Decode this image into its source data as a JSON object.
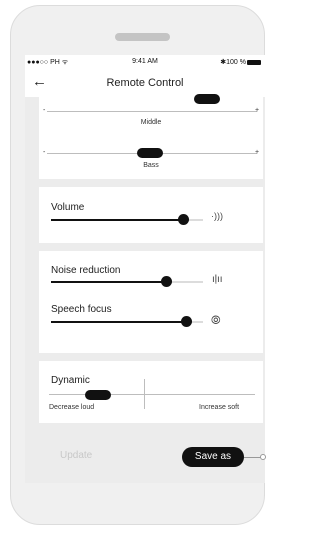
{
  "status_bar": {
    "carrier": "●●●○○ PH ᯤ",
    "time": "9:41 AM",
    "battery": "✱100 %"
  },
  "nav": {
    "back_icon": "arrow-left-icon",
    "title": "Remote Control"
  },
  "equalizer": {
    "middle": {
      "label": "Middle",
      "minus": "-",
      "plus": "+",
      "level": 0.8
    },
    "bass": {
      "label": "Bass",
      "minus": "-",
      "plus": "+",
      "level": 0.5
    }
  },
  "volume": {
    "label": "Volume",
    "level": 0.88,
    "icon": "speaker-waves-icon"
  },
  "noise_reduction": {
    "label": "Noise reduction",
    "level": 0.77,
    "icon": "noise-bars-icon"
  },
  "speech_focus": {
    "label": "Speech focus",
    "level": 0.9,
    "icon": "speech-focus-icon"
  },
  "dynamic": {
    "label": "Dynamic",
    "left_label": "Decrease loud",
    "right_label": "Increase soft",
    "level": 0.25
  },
  "actions": {
    "update_label": "Update",
    "save_as_label": "Save as"
  }
}
